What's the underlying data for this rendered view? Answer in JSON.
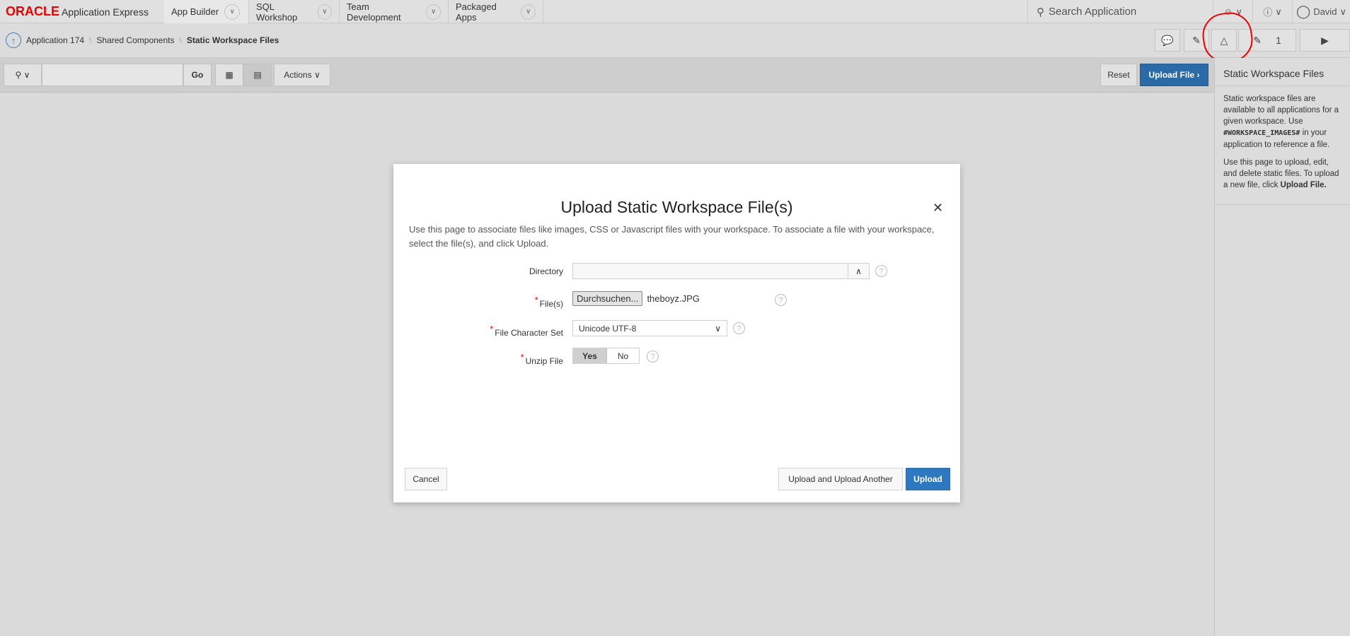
{
  "topbar": {
    "brand": "ORACLE",
    "product": "Application Express",
    "tabs": [
      "App Builder",
      "SQL Workshop",
      "Team Development",
      "Packaged Apps"
    ],
    "search_placeholder": "Search Application",
    "user": "David"
  },
  "breadcrumb": {
    "items": [
      "Application 174",
      "Shared Components",
      "Static Workspace Files"
    ]
  },
  "page_buttons": {
    "edit_count": "1"
  },
  "toolbar": {
    "go": "Go",
    "actions": "Actions",
    "reset": "Reset",
    "upload_file": "Upload File"
  },
  "right_panel": {
    "title": "Static Workspace Files",
    "p1_a": "Static workspace files are available to all applications for a given workspace. Use ",
    "p1_code": "#WORKSPACE_IMAGES#",
    "p1_b": " in your application to reference a file.",
    "p2_a": "Use this page to upload, edit, and delete static files. To upload a new file, click ",
    "p2_bold": "Upload File."
  },
  "dialog": {
    "title": "Upload Static Workspace File(s)",
    "description": "Use this page to associate files like images, CSS or Javascript files with your workspace. To associate a file with your workspace, select the file(s), and click Upload.",
    "directory_label": "Directory",
    "directory_value": "",
    "files_label": "File(s)",
    "browse_label": "Durchsuchen...",
    "file_name": "theboyz.JPG",
    "charset_label": "File Character Set",
    "charset_value": "Unicode UTF-8",
    "unzip_label": "Unzip File",
    "unzip_yes": "Yes",
    "unzip_no": "No",
    "unzip_selected": "Yes",
    "cancel": "Cancel",
    "upload_another": "Upload and Upload Another",
    "upload": "Upload"
  },
  "colors": {
    "primary": "#2e78bf",
    "required": "#ee0000",
    "annotation": "#ee0000"
  }
}
